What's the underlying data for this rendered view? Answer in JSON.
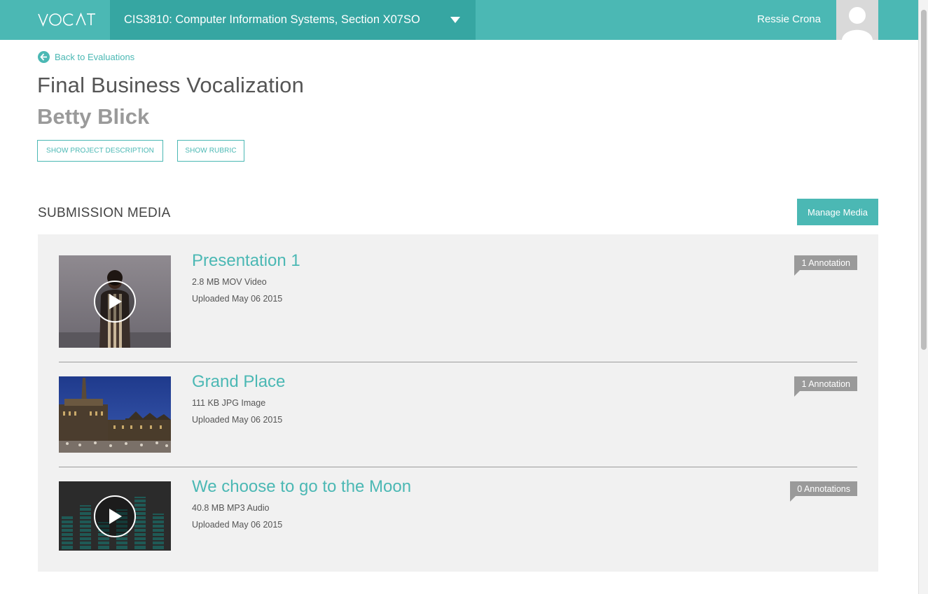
{
  "topbar": {
    "logo": "VOCAT",
    "course": "CIS3810: Computer Information Systems, Section X07SO",
    "username": "Ressie Crona"
  },
  "header": {
    "back_label": "Back to Evaluations",
    "title": "Final Business Vocalization",
    "student": "Betty Blick",
    "show_description": "SHOW PROJECT DESCRIPTION",
    "show_rubric": "SHOW RUBRIC"
  },
  "submission": {
    "section_title": "SUBMISSION MEDIA",
    "manage_label": "Manage Media",
    "items": [
      {
        "name": "Presentation 1",
        "size": "2.8 MB MOV Video",
        "uploaded": "Uploaded May 06 2015",
        "annotations": "1 Annotation",
        "kind": "video"
      },
      {
        "name": "Grand Place",
        "size": "111 KB JPG Image",
        "uploaded": "Uploaded May 06 2015",
        "annotations": "1 Annotation",
        "kind": "image"
      },
      {
        "name": "We choose to go to the Moon",
        "size": "40.8 MB MP3 Audio",
        "uploaded": "Uploaded May 06 2015",
        "annotations": "0 Annotations",
        "kind": "audio"
      }
    ]
  },
  "colors": {
    "accent": "#4bb8b4",
    "accent_dark": "#36a6a2",
    "badge": "#9a9a9a",
    "panel": "#f1f1f1"
  },
  "icons": [
    "back-arrow-icon",
    "chevron-down-icon",
    "user-avatar-icon",
    "play-icon"
  ]
}
